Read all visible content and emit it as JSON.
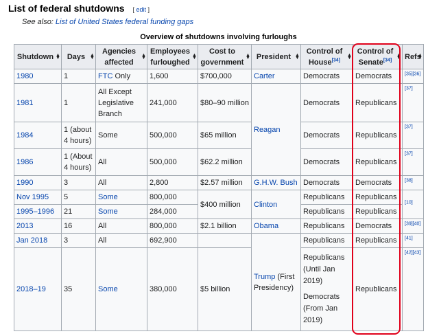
{
  "heading": {
    "title": "List of federal shutdowns",
    "edit_label": "edit",
    "edit_open": "[ ",
    "edit_close": " ]"
  },
  "see_also": {
    "prefix": "See also: ",
    "link": "List of United States federal funding gaps"
  },
  "table": {
    "caption": "Overview of shutdowns involving furloughs",
    "headers": {
      "shutdown": "Shutdown",
      "days": "Days",
      "agencies_l1": "Agencies",
      "agencies_l2": "affected",
      "employees_l1": "Employees",
      "employees_l2": "furloughed",
      "cost_l1": "Cost to",
      "cost_l2": "government",
      "president": "President",
      "house_l1": "Control of",
      "house_l2": "House",
      "house_ref": "[34]",
      "senate_l1": "Control of",
      "senate_l2": "Senate",
      "senate_ref": "[34]",
      "refs": "Refs"
    },
    "rows": [
      {
        "shutdown": "1980",
        "days": "1",
        "agencies_link": "FTC",
        "agencies_text": " Only",
        "employees": "1,600",
        "cost": "$700,000",
        "president": "Carter",
        "house": "Democrats",
        "senate": "Democrats",
        "ref1": "[35]",
        "ref2": "[36]"
      },
      {
        "shutdown": "1981",
        "days": "1",
        "agencies": "All Except Legislative Branch",
        "employees": "241,000",
        "cost": "$80–90 million",
        "president": "Reagan",
        "house": "Democrats",
        "senate": "Republicans",
        "ref1": "[37]"
      },
      {
        "shutdown": "1984",
        "days": "1 (about 4 hours)",
        "agencies": "Some",
        "employees": "500,000",
        "cost": "$65 million",
        "house": "Democrats",
        "senate": "Republicans",
        "ref1": "[37]"
      },
      {
        "shutdown": "1986",
        "days": "1 (About 4 hours)",
        "agencies": "All",
        "employees": "500,000",
        "cost": "$62.2 million",
        "house": "Democrats",
        "senate": "Republicans",
        "ref1": "[37]"
      },
      {
        "shutdown": "1990",
        "days": "3",
        "agencies": "All",
        "employees": "2,800",
        "cost": "$2.57 million",
        "president": "G.H.W. Bush",
        "house": "Democrats",
        "senate": "Democrats",
        "ref1": "[38]"
      },
      {
        "shutdown": "Nov 1995",
        "days": "5",
        "agencies": "Some",
        "employees": "800,000",
        "cost": "$400 million",
        "president": "Clinton",
        "house": "Republicans",
        "senate": "Republicans",
        "ref1": "[10]"
      },
      {
        "shutdown": "1995–1996",
        "days": "21",
        "agencies": "Some",
        "employees": "284,000",
        "house": "Republicans",
        "senate": "Republicans"
      },
      {
        "shutdown": "2013",
        "days": "16",
        "agencies": "All",
        "employees": "800,000",
        "cost": "$2.1 billion",
        "president": "Obama",
        "house": "Republicans",
        "senate": "Democrats",
        "ref1": "[39]",
        "ref2": "[40]"
      },
      {
        "shutdown": "Jan 2018",
        "days": "3",
        "agencies": "All",
        "employees": "692,900",
        "cost": "",
        "president_link": "Trump",
        "president_text": " (First Presidency)",
        "house": "Republicans",
        "senate": "Republicans",
        "ref1": "[41]"
      },
      {
        "shutdown": "2018–19",
        "days": "35",
        "agencies": "Some",
        "employees": "380,000",
        "cost": "$5 billion",
        "house_a": "Republicans (Until Jan 2019)",
        "house_b": "Democrats (From Jan 2019)",
        "senate": "Republicans",
        "ref1": "[42]",
        "ref2": "[43]"
      }
    ]
  },
  "colors": {
    "link": "#0645ad",
    "highlight": "#e0001a",
    "header_bg": "#eaecf0",
    "cell_bg": "#f8f9fa",
    "border": "#a2a9b1"
  }
}
